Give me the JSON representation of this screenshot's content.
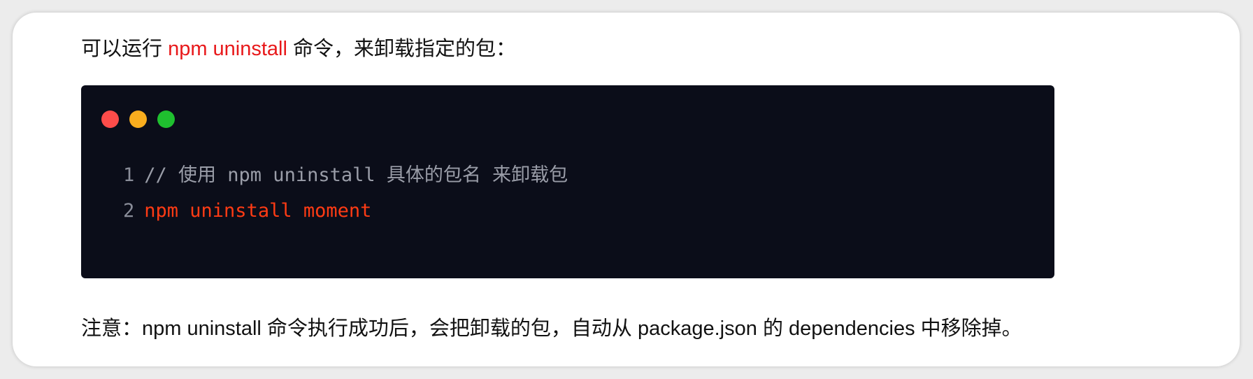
{
  "doc": {
    "intro_before": "可以运行 ",
    "intro_cmd": "npm uninstall",
    "intro_after": " 命令，来卸载指定的包：",
    "note": "注意：npm uninstall 命令执行成功后，会把卸载的包，自动从 package.json 的 dependencies 中移除掉。"
  },
  "code_window": {
    "dots": {
      "red": "#fe4c4a",
      "yellow": "#f9ad1e",
      "green": "#1fc02f"
    },
    "lines": [
      {
        "number": "1",
        "text": "// 使用 npm uninstall 具体的包名 来卸载包"
      },
      {
        "number": "2",
        "text": "npm uninstall moment"
      }
    ]
  }
}
